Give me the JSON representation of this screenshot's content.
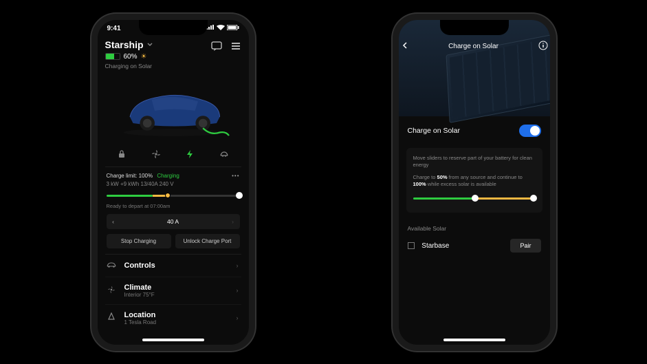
{
  "p1": {
    "status_time": "9:41",
    "vehicle_name": "Starship",
    "battery_pct": "60%",
    "charge_status": "Charging on Solar",
    "charge_limit_label": "Charge limit: 100%",
    "charge_state": "Charging",
    "charge_stats": "3 kW   +9 kWh   13/40A   240 V",
    "ready_msg": "Ready to depart at 07:00am",
    "amps": "40 A",
    "btn_stop": "Stop Charging",
    "btn_unlock": "Unlock Charge Port",
    "menu": {
      "controls": "Controls",
      "climate": "Climate",
      "climate_sub": "Interior 75°F",
      "location": "Location",
      "location_sub": "1 Tesla Road"
    }
  },
  "p2": {
    "title": "Charge on Solar",
    "toggle_label": "Charge on Solar",
    "info_line1": "Move sliders to reserve part of your battery for clean energy",
    "info_line2a": "Charge to ",
    "info_pct1": "50%",
    "info_line2b": " from any source and continue to ",
    "info_pct2": "100%",
    "info_line2c": " while excess solar is available",
    "avail_label": "Available Solar",
    "powerwall_name": "Starbase",
    "pair_btn": "Pair"
  }
}
